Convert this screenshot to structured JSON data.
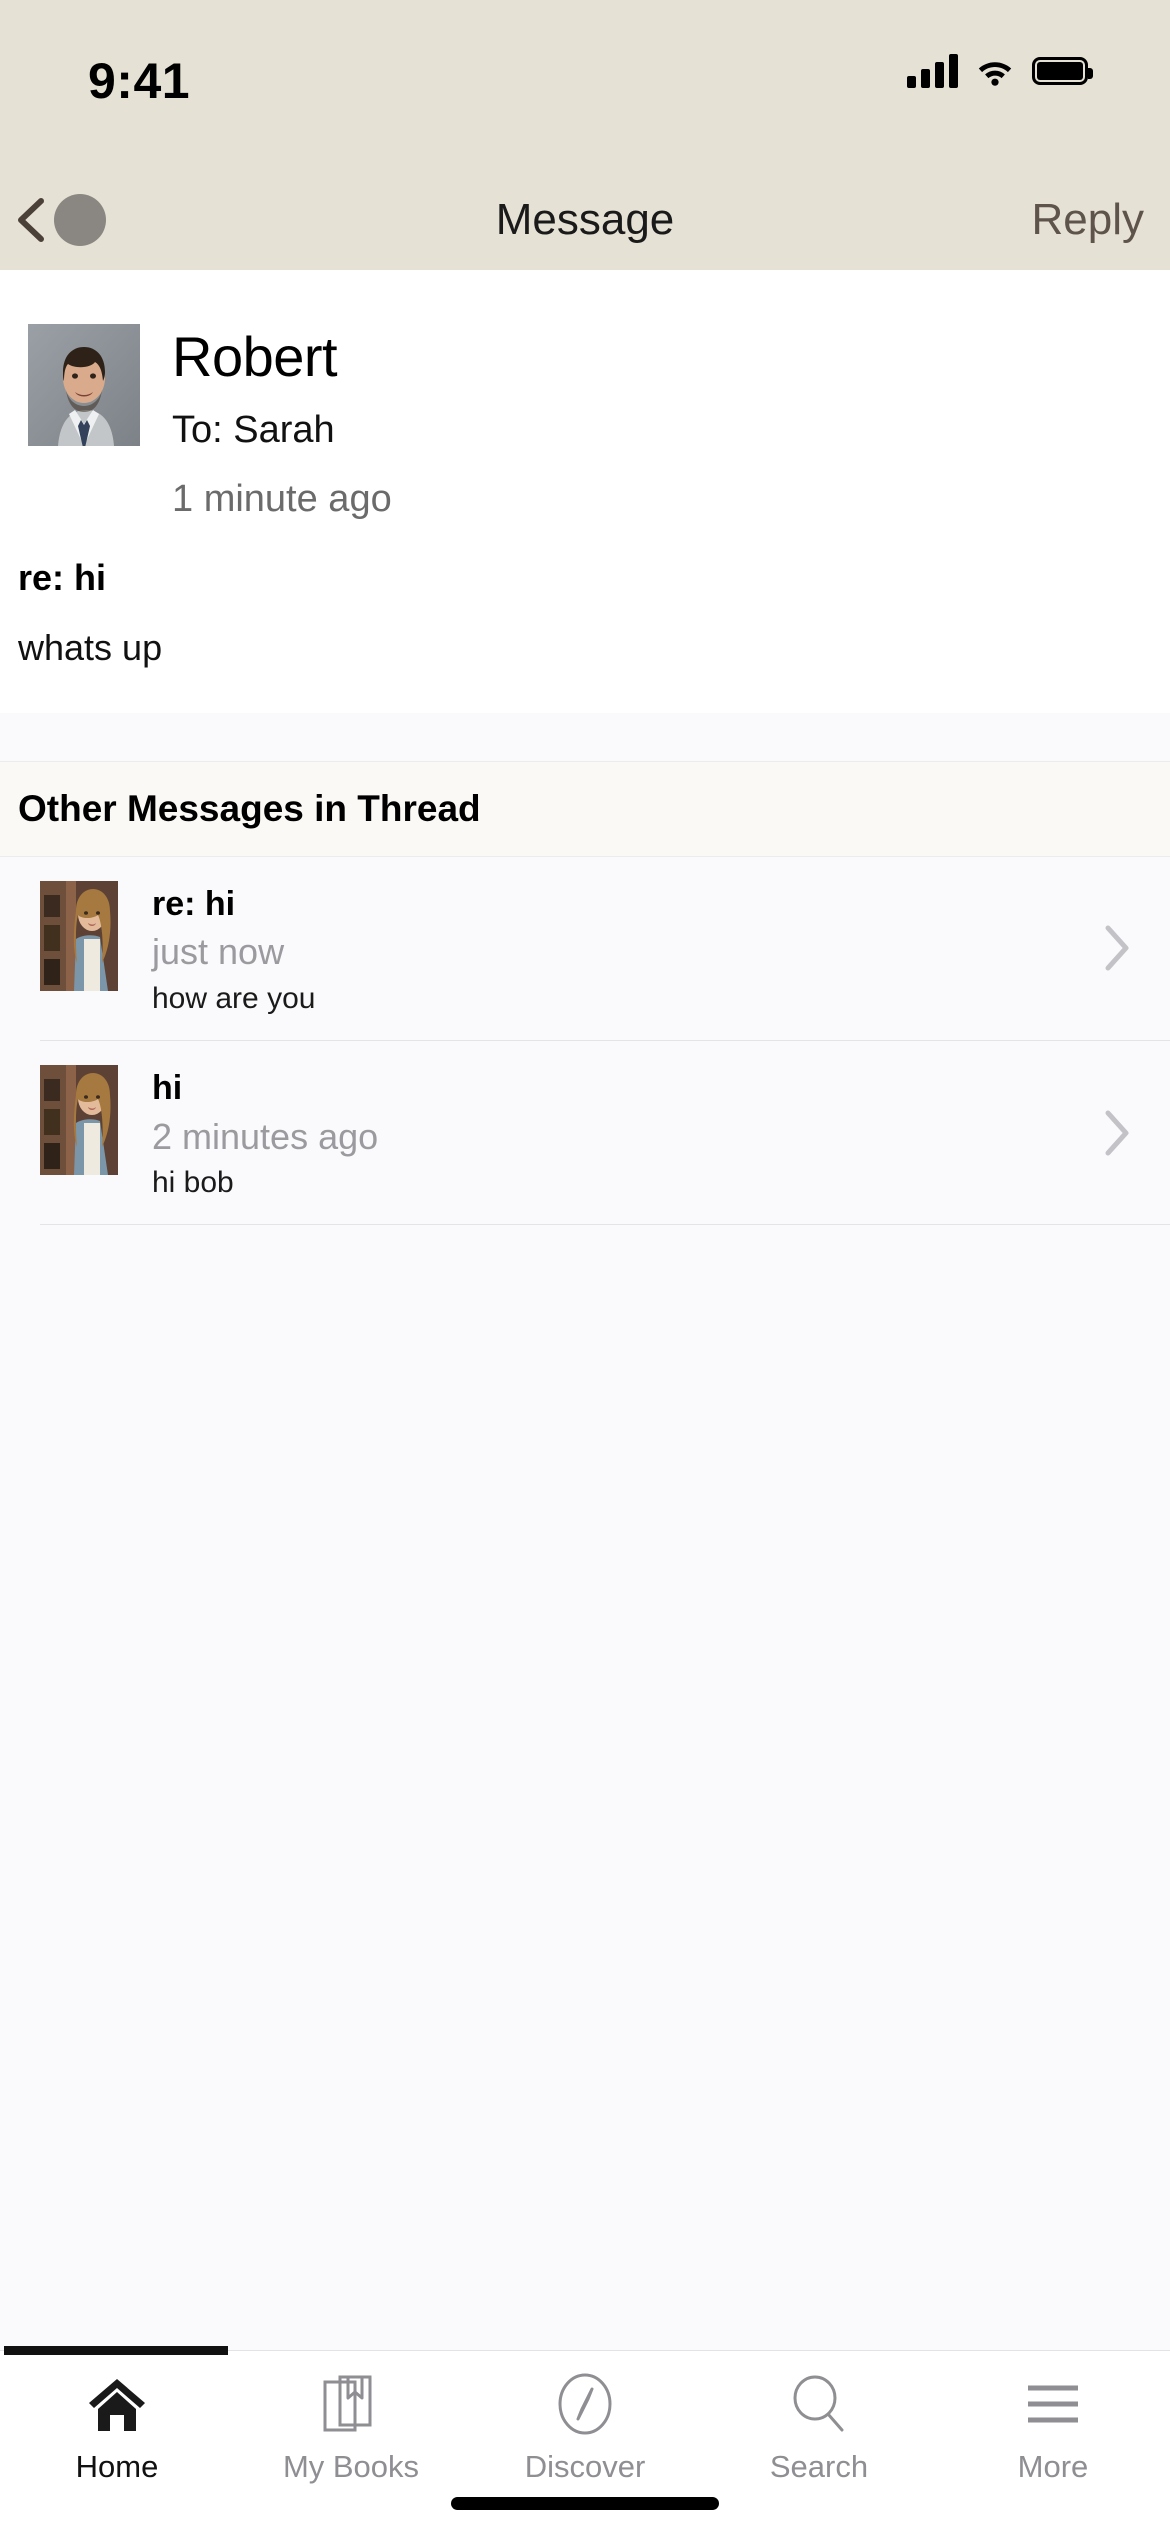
{
  "status_bar": {
    "time": "9:41",
    "signal_icon": "cellular-signal-icon",
    "wifi_icon": "wifi-icon",
    "battery_icon": "battery-full-icon"
  },
  "nav_bar": {
    "back_icon": "back-chevron-icon",
    "avatar_icon": "nav-avatar-icon",
    "title": "Message",
    "reply_label": "Reply"
  },
  "message": {
    "avatar_icon": "sender-avatar-photo",
    "sender": "Robert",
    "recipient": "To: Sarah",
    "time": "1 minute ago",
    "subject": "re: hi",
    "body": "whats up"
  },
  "thread_section": {
    "header": "Other Messages in Thread",
    "items": [
      {
        "avatar_icon": "thread-avatar-photo",
        "title": "re: hi",
        "time": "just now",
        "preview": "how are you",
        "chevron_icon": "chevron-right-icon"
      },
      {
        "avatar_icon": "thread-avatar-photo",
        "title": "hi",
        "time": "2 minutes ago",
        "preview": "hi bob",
        "chevron_icon": "chevron-right-icon"
      }
    ]
  },
  "tab_bar": {
    "tabs": [
      {
        "label": "Home",
        "icon": "home-icon",
        "active": true
      },
      {
        "label": "My Books",
        "icon": "books-icon",
        "active": false
      },
      {
        "label": "Discover",
        "icon": "compass-icon",
        "active": false
      },
      {
        "label": "Search",
        "icon": "search-icon",
        "active": false
      },
      {
        "label": "More",
        "icon": "hamburger-icon",
        "active": false
      }
    ]
  },
  "colors": {
    "header_background": "#e6e1d5",
    "page_background": "#faf9fb",
    "message_background": "#ffffff",
    "reply_text": "#5e544b",
    "muted_text": "#9a9a9f",
    "active_tab": "#111111",
    "inactive_tab": "#8e8e93"
  }
}
